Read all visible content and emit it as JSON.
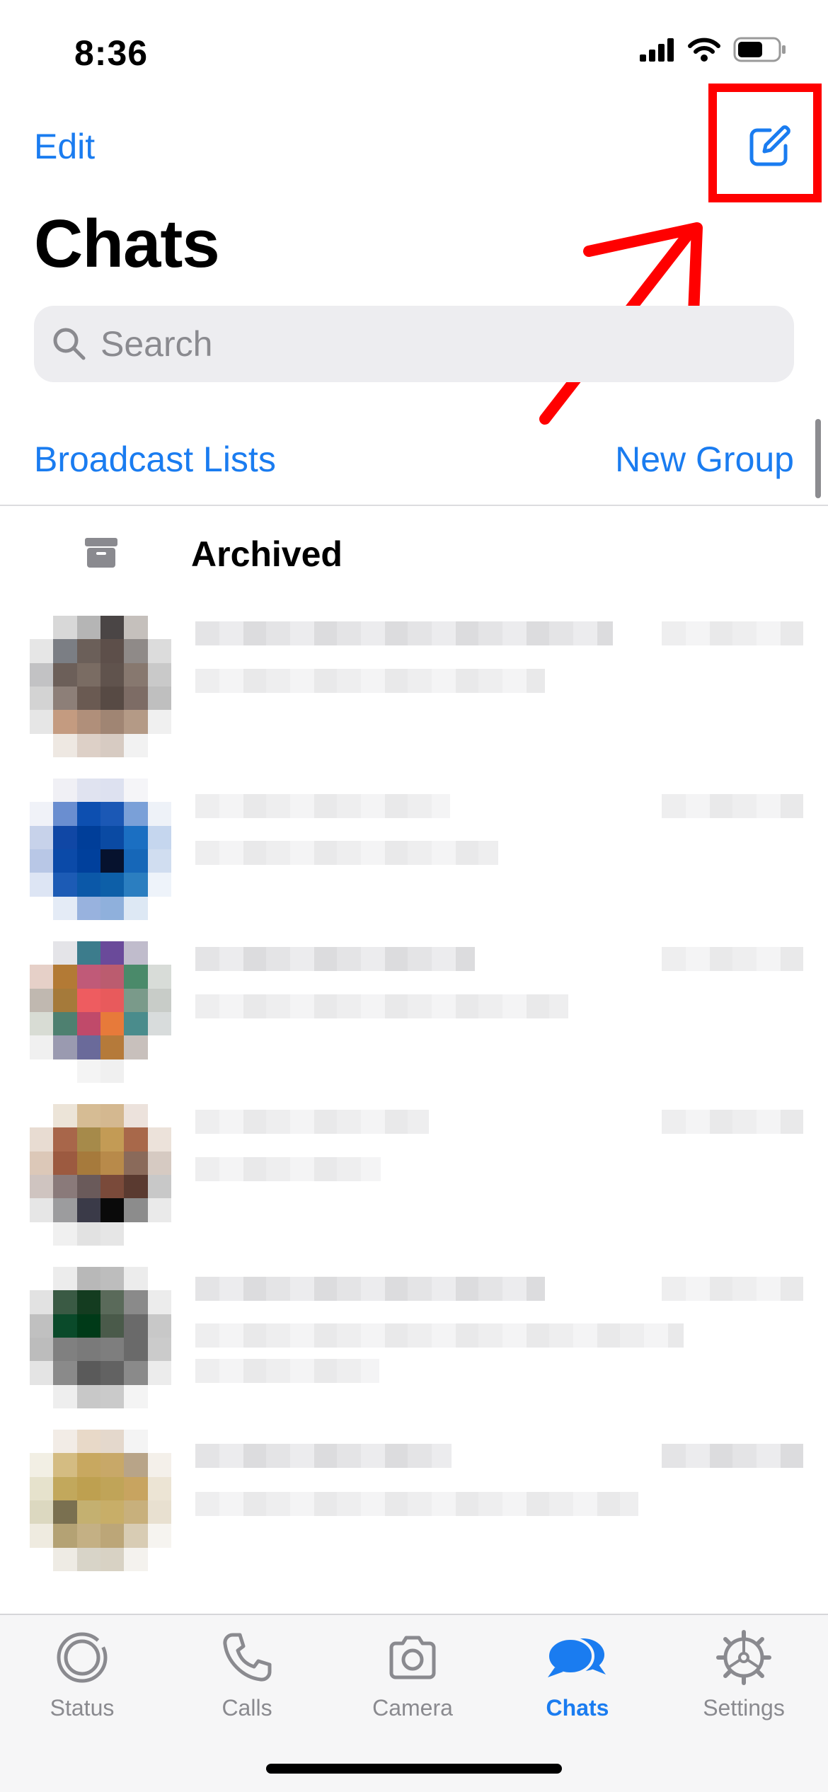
{
  "status_bar": {
    "time": "8:36"
  },
  "header": {
    "edit_label": "Edit",
    "title": "Chats"
  },
  "search": {
    "placeholder": "Search"
  },
  "links": {
    "broadcast": "Broadcast Lists",
    "new_group": "New Group"
  },
  "archived": {
    "label": "Archived"
  },
  "tabs": [
    {
      "label": "Status",
      "icon": "status-icon",
      "active": false
    },
    {
      "label": "Calls",
      "icon": "phone-icon",
      "active": false
    },
    {
      "label": "Camera",
      "icon": "camera-icon",
      "active": false
    },
    {
      "label": "Chats",
      "icon": "chats-icon",
      "active": true
    },
    {
      "label": "Settings",
      "icon": "gear-icon",
      "active": false
    }
  ],
  "colors": {
    "accent": "#1a7cf0",
    "annotation": "#ff0000",
    "search_bg": "#ededf0",
    "tabbar_bg": "#f6f6f7"
  }
}
